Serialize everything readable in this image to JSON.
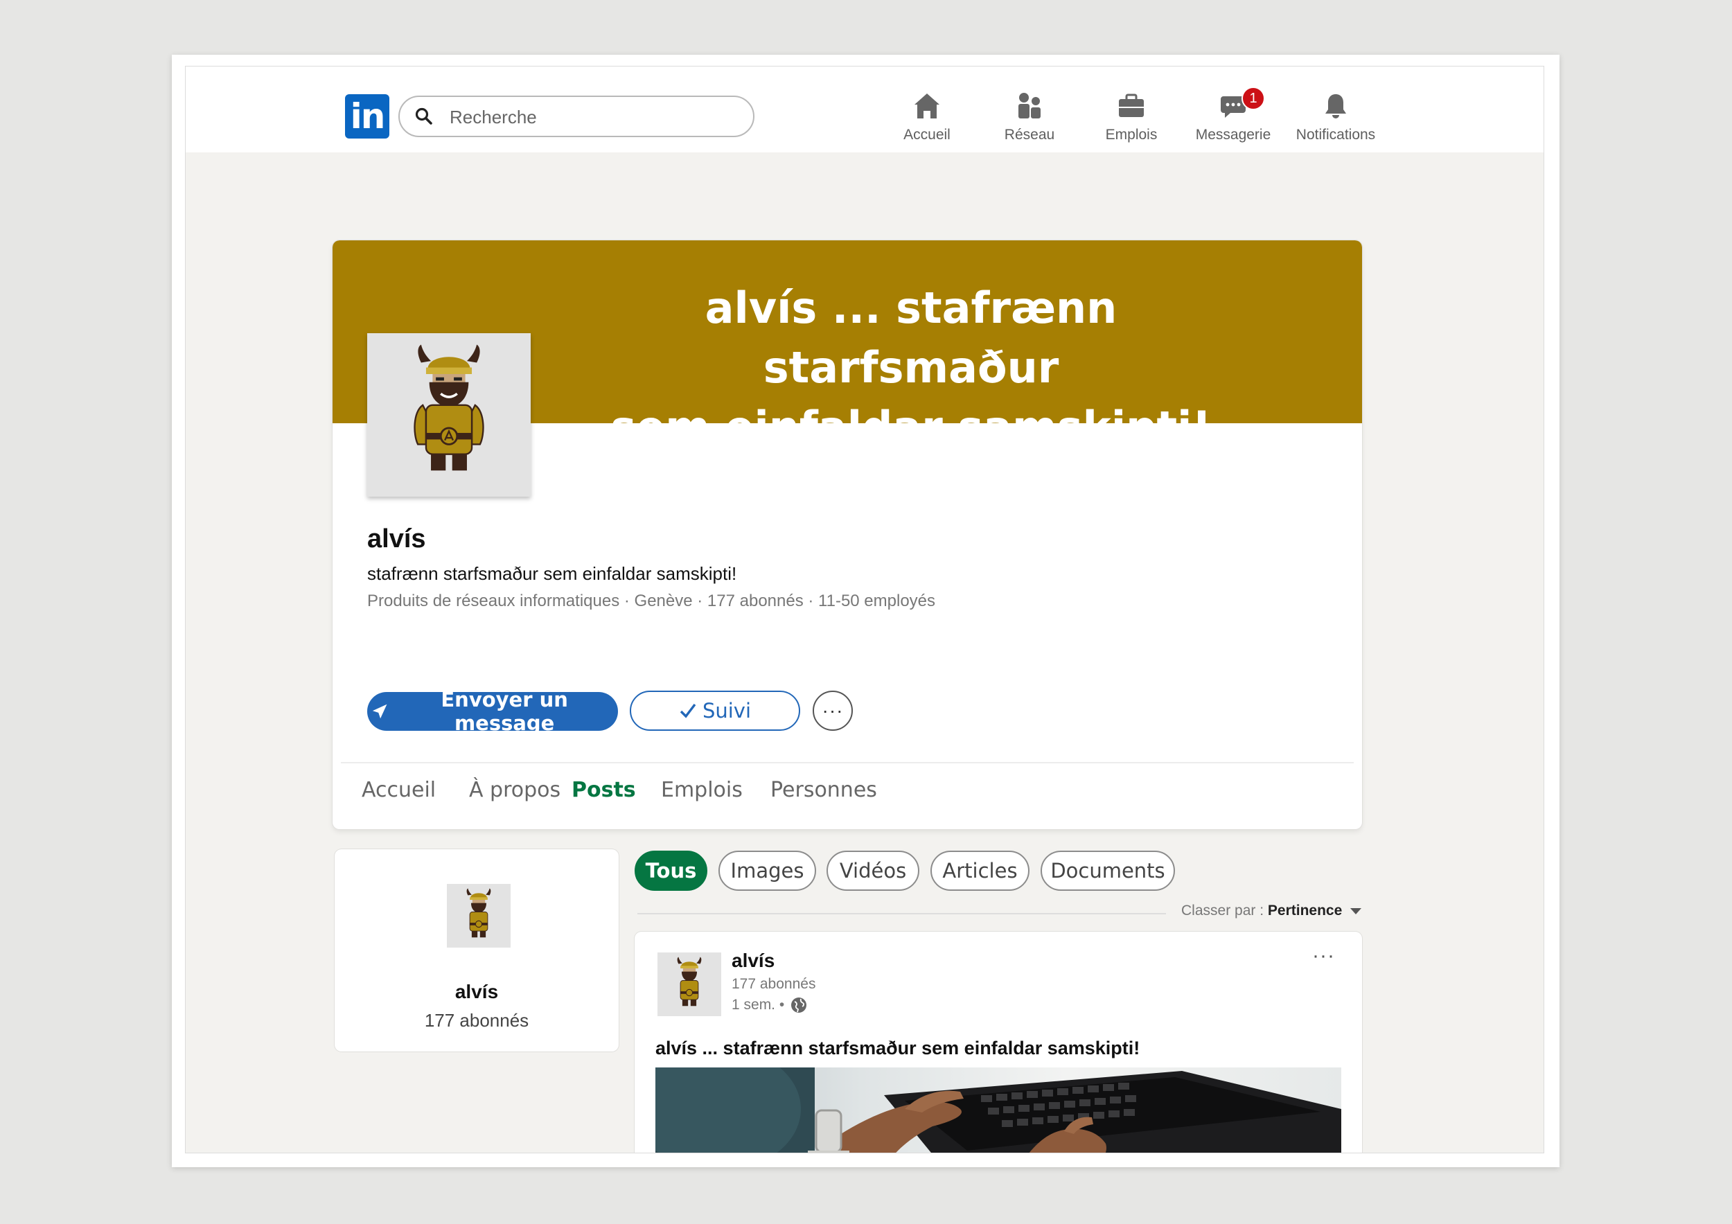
{
  "nav": {
    "logo": "in",
    "search_placeholder": "Recherche",
    "items": [
      {
        "label": "Accueil",
        "icon": "home-icon"
      },
      {
        "label": "Réseau",
        "icon": "network-icon"
      },
      {
        "label": "Emplois",
        "icon": "briefcase-icon"
      },
      {
        "label": "Messagerie",
        "icon": "messaging-icon",
        "badge": "1"
      },
      {
        "label": "Notifications",
        "icon": "bell-icon"
      }
    ]
  },
  "profile": {
    "banner_line1": "alvís ... stafrænn starfsmaður",
    "banner_line2": "sem einfaldar samskipti!",
    "name": "alvís",
    "tagline": "stafrænn starfsmaður sem einfaldar samskipti!",
    "meta": "Produits de réseaux informatiques · Genève · 177 abonnés · 11-50 employés",
    "message_button": "Envoyer un message",
    "follow_button": "Suivi",
    "more_button": "···"
  },
  "tabs": [
    {
      "label": "Accueil",
      "active": false
    },
    {
      "label": "À propos",
      "active": false
    },
    {
      "label": "Posts",
      "active": true
    },
    {
      "label": "Emplois",
      "active": false
    },
    {
      "label": "Personnes",
      "active": false
    }
  ],
  "sidebar_card": {
    "name": "alvís",
    "followers": "177 abonnés"
  },
  "filters": [
    {
      "label": "Tous",
      "active": true
    },
    {
      "label": "Images",
      "active": false
    },
    {
      "label": "Vidéos",
      "active": false
    },
    {
      "label": "Articles",
      "active": false
    },
    {
      "label": "Documents",
      "active": false
    }
  ],
  "sort": {
    "label": "Classer par :",
    "value": "Pertinence"
  },
  "post": {
    "author": "alvís",
    "followers": "177 abonnés",
    "time": "1 sem. •",
    "more": "···",
    "text": "alvís ... stafrænn starfsmaður sem einfaldar samskipti!"
  },
  "colors": {
    "brand_blue": "#0a66c2",
    "banner_gold": "#a67f03",
    "active_green": "#057642",
    "button_blue": "#2267b8",
    "badge_red": "#cc1016"
  }
}
